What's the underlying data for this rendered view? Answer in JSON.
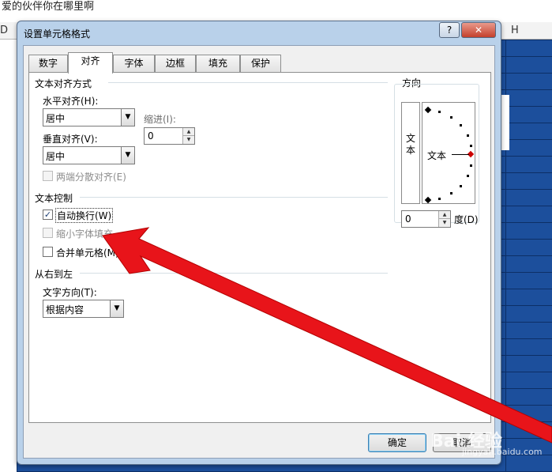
{
  "background": {
    "title": "爱的伙伴你在哪里啊",
    "col_d": "D",
    "col_h": "H"
  },
  "dialog": {
    "title": "设置单元格格式",
    "help": "?",
    "close": "✕",
    "tabs": [
      "数字",
      "对齐",
      "字体",
      "边框",
      "填充",
      "保护"
    ],
    "active_tab": "对齐",
    "text_alignment": {
      "title": "文本对齐方式",
      "horizontal_label": "水平对齐(H):",
      "horizontal_value": "居中",
      "indent_label": "缩进(I):",
      "indent_value": "0",
      "vertical_label": "垂直对齐(V):",
      "vertical_value": "居中",
      "justify_distributed": "两端分散对齐(E)"
    },
    "text_control": {
      "title": "文本控制",
      "wrap_text": "自动换行(W)",
      "wrap_checked": true,
      "shrink_to_fit": "缩小字体填充",
      "shrink_checked": false,
      "merge_cells": "合并单元格(M)",
      "merge_checked": false
    },
    "rtl": {
      "title": "从右到左",
      "direction_label": "文字方向(T):",
      "direction_value": "根据内容"
    },
    "orientation": {
      "title": "方向",
      "vertical_text": "文本",
      "dial_text": "文本",
      "degrees_value": "0",
      "degrees_label": "度(D)"
    },
    "buttons": {
      "ok": "确定",
      "cancel": "取消"
    }
  },
  "watermark": {
    "text": "Bai  经验",
    "sub": "jingyan.baidu.com"
  },
  "colors": {
    "sheet_blue": "#1c4f9c",
    "arrow_red": "#e8141a"
  }
}
